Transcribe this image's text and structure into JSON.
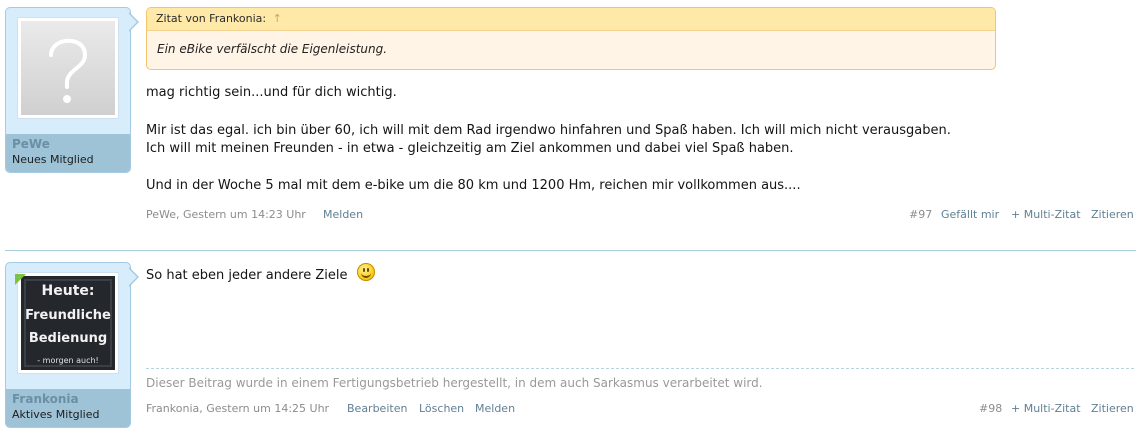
{
  "posts": [
    {
      "username": "PeWe",
      "user_title": "Neues Mitglied",
      "avatar": "default-question-mark-avatar",
      "quote": {
        "header": "Zitat von Frankonia:",
        "arrow": "↑",
        "text": "Ein eBike verfälscht die Eigenleistung."
      },
      "paragraphs": [
        "mag richtig sein...und für dich wichtig.",
        "Mir ist das egal. ich bin über 60, ich will mit dem Rad irgendwo hinfahren und Spaß haben. Ich will mich nicht verausgaben.",
        "Ich will mit meinen Freunden - in etwa - gleichzeitig am Ziel ankommen und dabei viel Spaß haben.",
        "Und in der Woche 5 mal mit dem e-bike um die 80 km und 1200 Hm, reichen mir vollkommen aus...."
      ],
      "meta": {
        "author_date": "PeWe, Gestern um 14:23 Uhr",
        "report": "Melden",
        "post_number": "#97",
        "like": "Gefällt mir",
        "multiquote": "+ Multi-Zitat",
        "quote": "Zitieren"
      }
    },
    {
      "username": "Frankonia",
      "user_title": "Aktives Mitglied",
      "avatar_lines": [
        "Heute:",
        "Freundliche",
        "Bedienung",
        "- morgen auch!"
      ],
      "message": "So hat eben jeder andere Ziele",
      "smiley": "smile",
      "signature": "Dieser Beitrag wurde in einem Fertigungsbetrieb hergestellt, in dem auch Sarkasmus verarbeitet wird.",
      "meta": {
        "author_date": "Frankonia, Gestern um 14:25 Uhr",
        "edit": "Bearbeiten",
        "delete": "Löschen",
        "report": "Melden",
        "post_number": "#98",
        "multiquote": "+ Multi-Zitat",
        "quote": "Zitieren"
      }
    }
  ],
  "colors": {
    "link": "#5f7f93",
    "quote_background": "#fff4e5",
    "quote_border": "#f5c46c",
    "user_panel": "#d7edfc",
    "user_footer": "#9ec2d6"
  }
}
